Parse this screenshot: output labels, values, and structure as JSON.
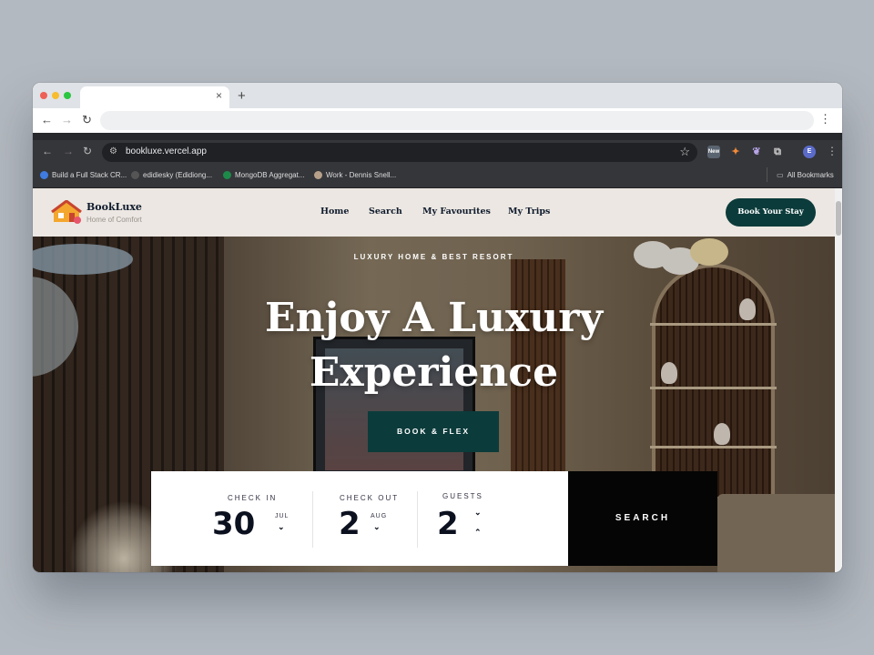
{
  "browser": {
    "outer_tab_close": "×",
    "outer_new_tab": "+",
    "url": "bookluxe.vercel.app",
    "bookmarks": [
      "Build a Full Stack CR...",
      "edidiesky (Edidiong...",
      "MongoDB Aggregat...",
      "Work - Dennis Snell..."
    ],
    "all_bookmarks": "All Bookmarks",
    "profile_initial": "E",
    "new_badge": "New"
  },
  "site": {
    "brand": {
      "name": "BookLuxe",
      "tagline": "Home of Comfort"
    },
    "nav": [
      "Home",
      "Search",
      "My Favourites",
      "My Trips"
    ],
    "cta": "Book Your Stay",
    "hero": {
      "eyebrow": "LUXURY HOME & BEST RESORT",
      "headline_line1": "Enjoy A Luxury",
      "headline_line2": "Experience",
      "button": "BOOK & FLEX"
    },
    "booking": {
      "check_in_label": "CHECK IN",
      "check_in_day": "30",
      "check_in_month": "JUL",
      "check_out_label": "CHECK OUT",
      "check_out_day": "2",
      "check_out_month": "AUG",
      "guests_label": "GUESTS",
      "guests_value": "2",
      "search_label": "SEARCH"
    }
  },
  "colors": {
    "brand_teal": "#0c3b3b",
    "nav_bg": "#ece7e2",
    "search_bg": "#050505"
  }
}
